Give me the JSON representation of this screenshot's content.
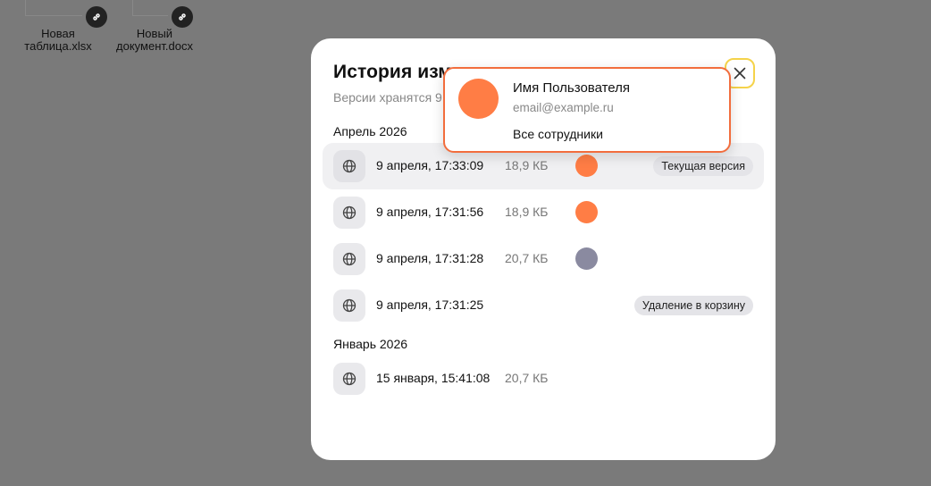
{
  "background": {
    "files": [
      {
        "name": "Новая\nтаблица.xlsx"
      },
      {
        "name": "Новый\nдокумент.docx"
      }
    ]
  },
  "modal": {
    "title": "История изм",
    "subtitle": "Версии хранятся 9",
    "close_icon": "close-icon",
    "sections": [
      {
        "title": "Апрель 2026",
        "rows": [
          {
            "date": "9 апреля, 17:33:09",
            "size": "18,9 КБ",
            "author_color": "#ff7d45",
            "tag": "Текущая версия",
            "current": true
          },
          {
            "date": "9 апреля, 17:31:56",
            "size": "18,9 КБ",
            "author_color": "#ff7d45",
            "tag": "",
            "current": false
          },
          {
            "date": "9 апреля, 17:31:28",
            "size": "20,7 КБ",
            "author_color": "#8a8aa0",
            "tag": "",
            "current": false
          },
          {
            "date": "9 апреля, 17:31:25",
            "size": "",
            "author_color": "",
            "tag": "Удаление в корзину",
            "current": false
          }
        ]
      },
      {
        "title": "Январь 2026",
        "rows": [
          {
            "date": "15 января, 15:41:08",
            "size": "20,7 КБ",
            "author_color": "",
            "tag": "",
            "current": false
          }
        ]
      }
    ]
  },
  "popover": {
    "name": "Имя Пользователя",
    "email": "email@example.ru",
    "group": "Все сотрудники",
    "avatar_color": "#ff7d45"
  },
  "colors": {
    "accent_orange": "#f26d3d",
    "focus_yellow": "#f5d34a"
  }
}
